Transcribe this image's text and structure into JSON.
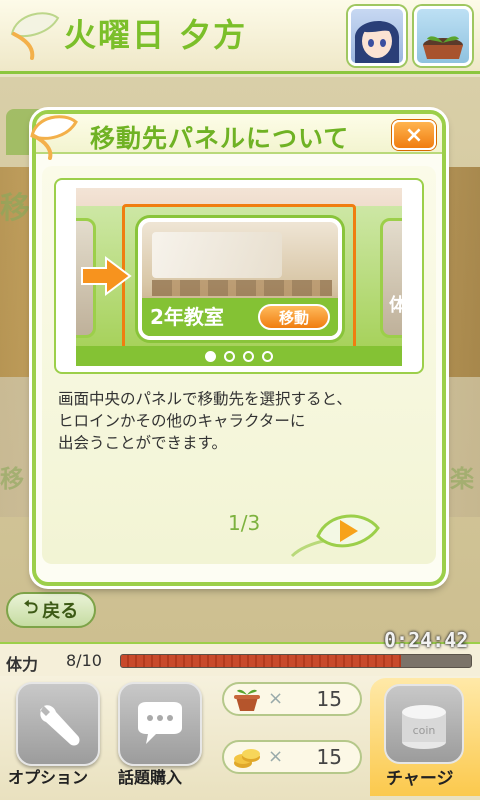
{
  "header": {
    "day_title": "火曜日 夕方"
  },
  "background": {
    "partial_left_top": "移",
    "partial_left_bottom": "移",
    "partial_right_bottom": "楽",
    "back_label": "戻る"
  },
  "modal": {
    "title": "移動先パネルについて",
    "close_label": "×",
    "preview": {
      "location_name": "2年教室",
      "move_label": "移動",
      "side_label_right": "体",
      "dots_total": 4,
      "dots_active": 1
    },
    "description_lines": [
      "画面中央のパネルで移動先を選択すると、",
      "ヒロインかその他のキャラクターに",
      "出会うことができます。"
    ],
    "page_indicator": "1/3"
  },
  "status": {
    "stamina_label": "体力",
    "stamina_value": "8/10",
    "stamina_fraction": 0.8,
    "timer": "0:24:42"
  },
  "bottom_bar": {
    "options_label": "オプション",
    "topic_label": "話題購入",
    "seed_times": "×",
    "seed_count": "15",
    "coin_times": "×",
    "coin_count": "15",
    "coin_icon_text": "coin",
    "charge_label": "チャージ"
  },
  "colors": {
    "accent_green": "#8cc63e",
    "accent_orange": "#f07d10"
  }
}
